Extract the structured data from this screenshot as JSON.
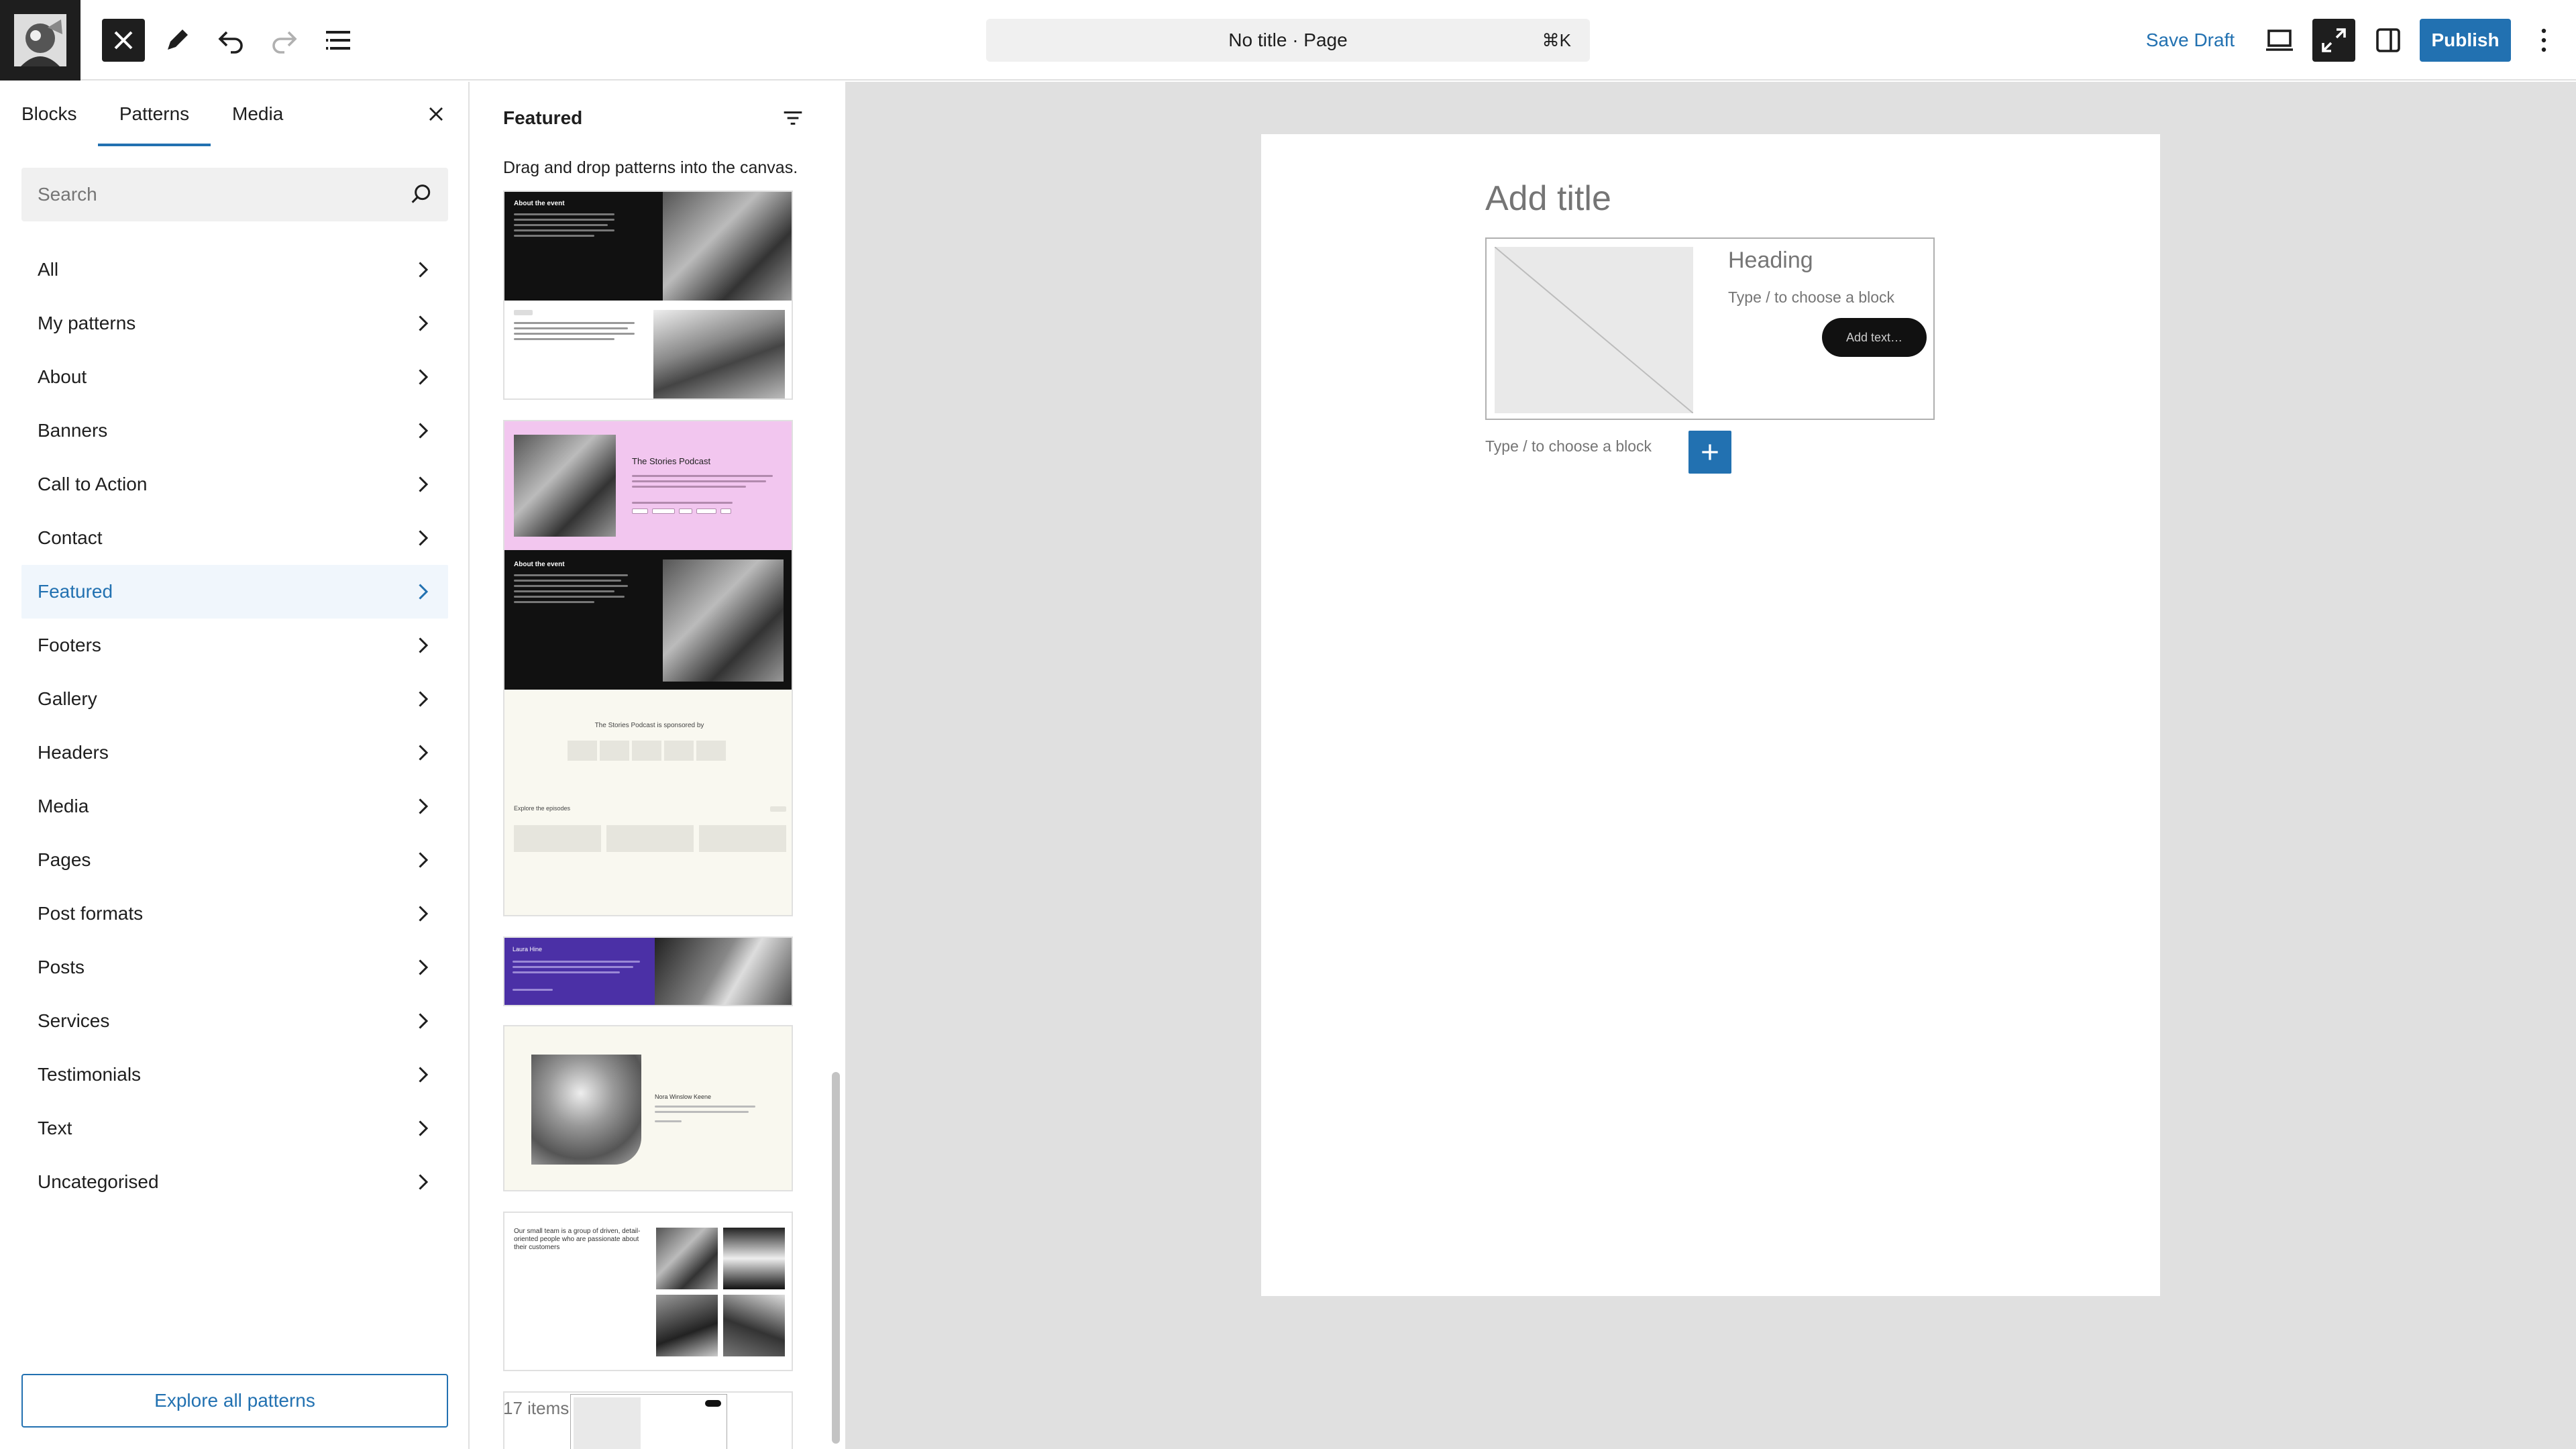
{
  "topbar": {
    "document_title": "No title · Page",
    "shortcut": "⌘K",
    "save_draft": "Save Draft",
    "publish": "Publish"
  },
  "inserter": {
    "tabs": [
      "Blocks",
      "Patterns",
      "Media"
    ],
    "active_tab": "Patterns",
    "search_placeholder": "Search",
    "categories": [
      "All",
      "My patterns",
      "About",
      "Banners",
      "Call to Action",
      "Contact",
      "Featured",
      "Footers",
      "Gallery",
      "Headers",
      "Media",
      "Pages",
      "Post formats",
      "Posts",
      "Services",
      "Testimonials",
      "Text",
      "Uncategorised"
    ],
    "active_category": "Featured",
    "explore_button": "Explore all patterns"
  },
  "patterns": {
    "title": "Featured",
    "description": "Drag and drop patterns into the canvas.",
    "items_count": "17 items",
    "previews": {
      "about_event": "About the event",
      "podcast": "The Stories Podcast",
      "sponsor": "The Stories Podcast is sponsored by",
      "episodes": "Explore the episodes",
      "laura": "Laura Hine",
      "nora": "Nora Winslow Keene",
      "team": "Our small team is a group of driven, detail-oriented people who are passionate about their customers"
    }
  },
  "canvas": {
    "title_placeholder": "Add title",
    "heading": "Heading",
    "paragraph_placeholder": "Type / to choose a block",
    "button_text": "Add text…",
    "block_hint": "Type / to choose a block"
  },
  "colors": {
    "accent": "#2271b1",
    "dark": "#1e1e1e",
    "canvas_bg": "#e0e0e0",
    "active_category_bg": "#f0f6fc"
  },
  "icons": [
    "site-logo",
    "close-icon",
    "pencil-icon",
    "undo-icon",
    "redo-icon",
    "list-view-icon",
    "view-icon",
    "fullscreen-icon",
    "sidebar-icon",
    "more-icon",
    "search-icon",
    "chevron-right-icon",
    "filter-icon",
    "plus-icon"
  ]
}
